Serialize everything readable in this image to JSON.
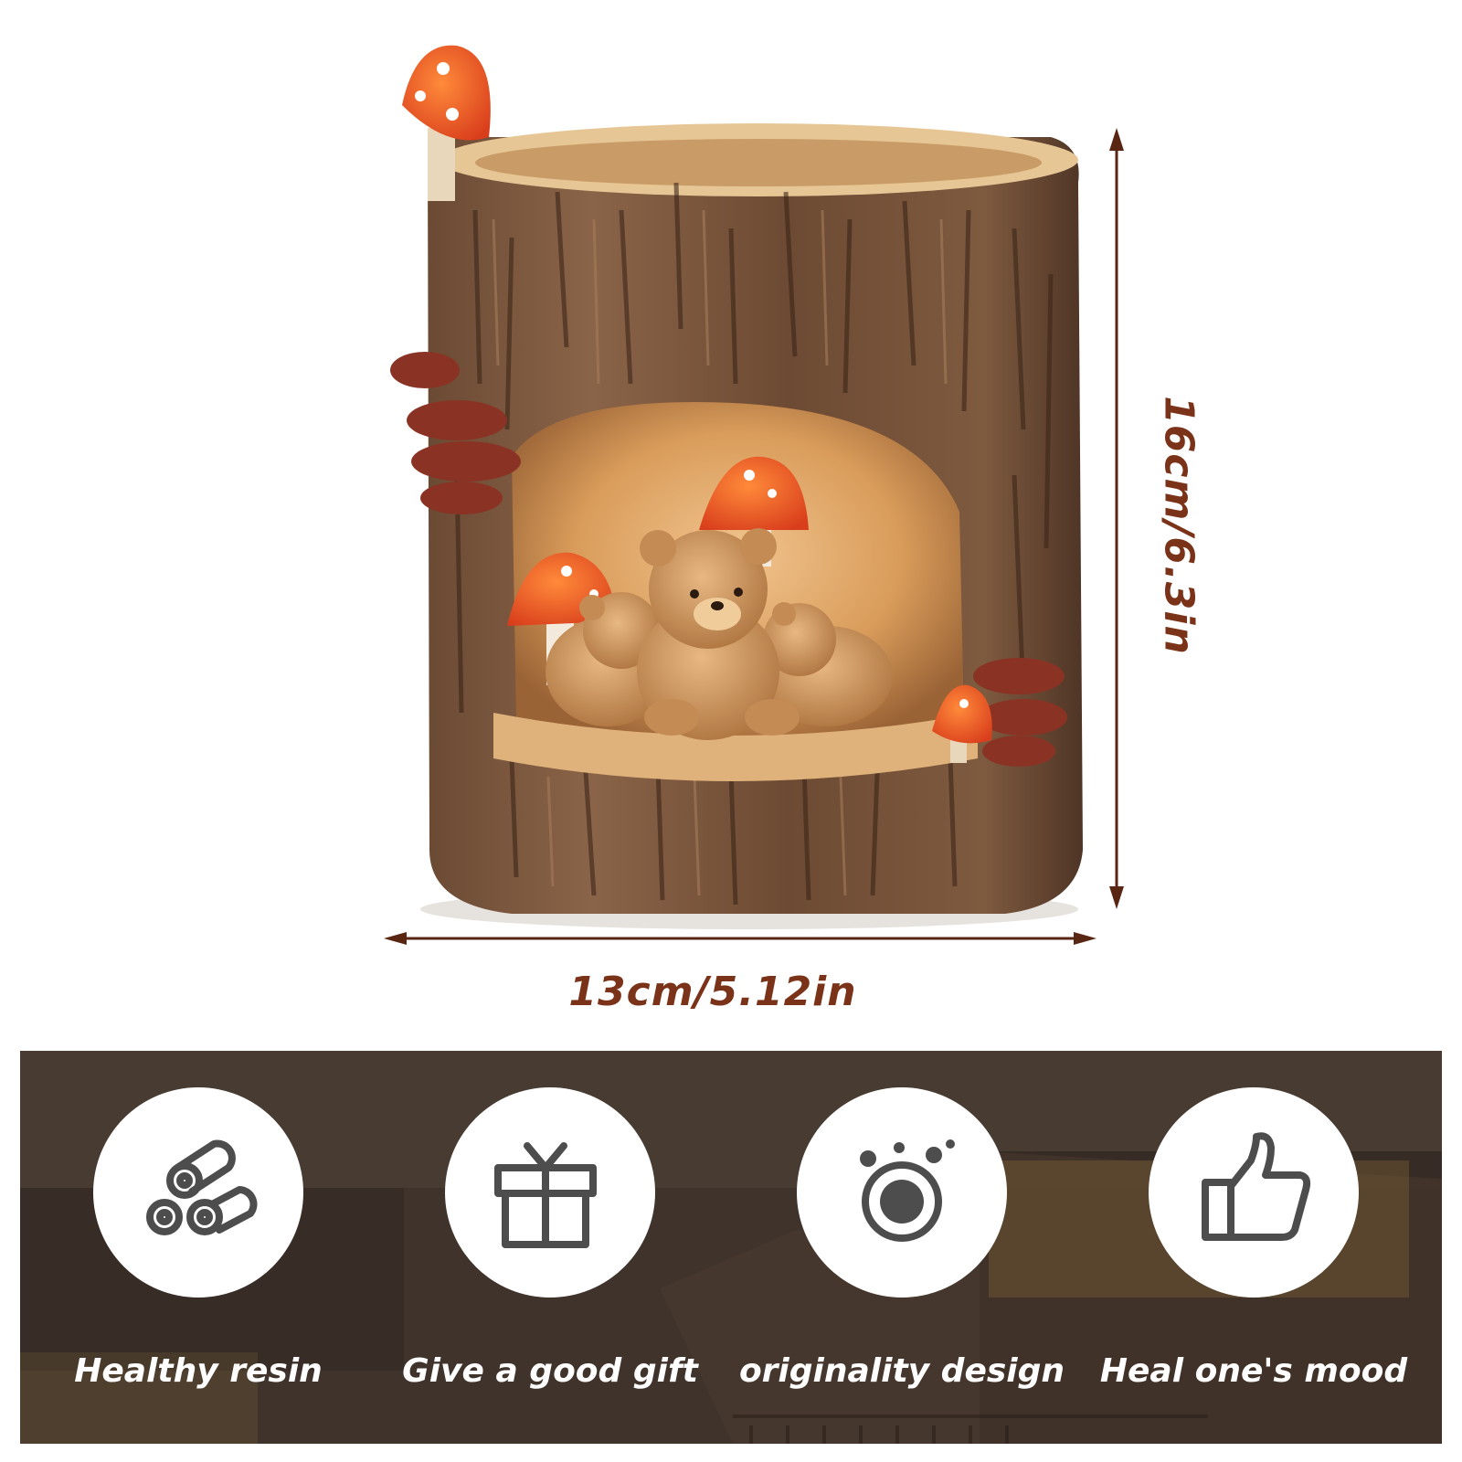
{
  "dimensions": {
    "width_label": "13cm/5.12in",
    "height_label": "16cm/6.3in",
    "arrow_color": "#5a2614",
    "label_color": "#7a3318"
  },
  "features": [
    {
      "label": "Healthy resin",
      "icon": "logs-icon"
    },
    {
      "label": "Give a good gift",
      "icon": "gift-box-icon"
    },
    {
      "label": "originality design",
      "icon": "camera-lens-icon"
    },
    {
      "label": "Heal one's mood",
      "icon": "thumbs-up-icon"
    }
  ],
  "colors": {
    "band_background": "#3d302a",
    "circle_fill": "#ffffff",
    "icon_stroke": "#4d4d4d"
  }
}
